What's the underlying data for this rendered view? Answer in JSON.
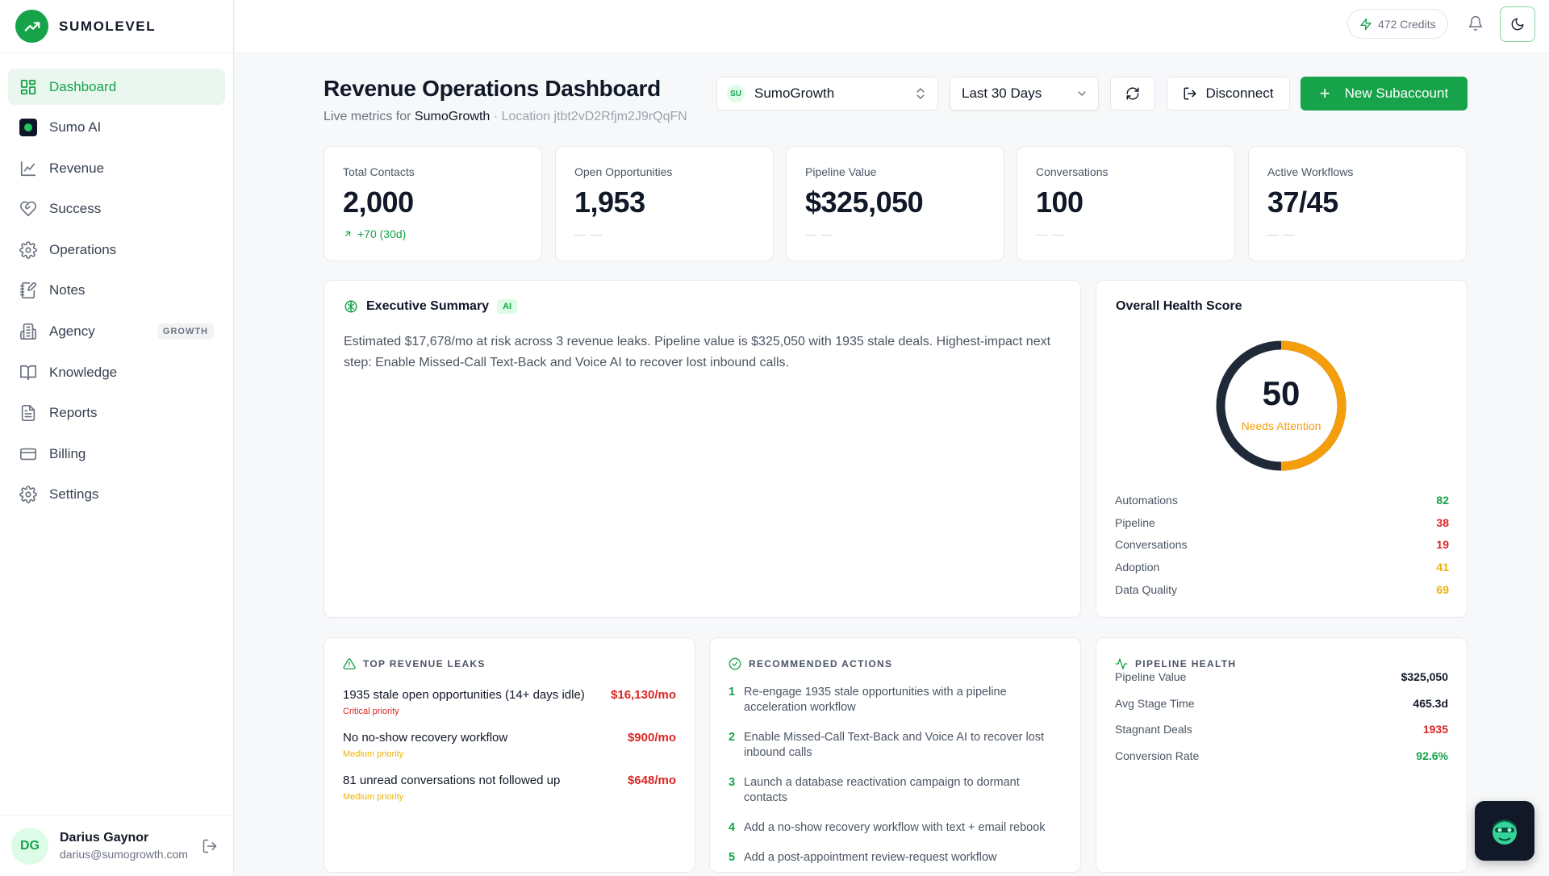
{
  "brand": {
    "name": "SUMOLEVEL"
  },
  "sidebar": {
    "items": [
      {
        "label": "Dashboard",
        "icon": "dashboard-icon",
        "active": true
      },
      {
        "label": "Sumo AI",
        "icon": "sumo-ai-icon"
      },
      {
        "label": "Revenue",
        "icon": "line-chart-icon"
      },
      {
        "label": "Success",
        "icon": "heart-handshake-icon"
      },
      {
        "label": "Operations",
        "icon": "gear-icon"
      },
      {
        "label": "Notes",
        "icon": "notes-icon"
      },
      {
        "label": "Agency",
        "icon": "building-icon",
        "badge": "GROWTH"
      },
      {
        "label": "Knowledge",
        "icon": "book-icon"
      },
      {
        "label": "Reports",
        "icon": "file-text-icon"
      },
      {
        "label": "Billing",
        "icon": "credit-card-icon"
      },
      {
        "label": "Settings",
        "icon": "settings-icon"
      }
    ]
  },
  "user": {
    "initials": "DG",
    "name": "Darius Gaynor",
    "email": "darius@sumogrowth.com"
  },
  "topbar": {
    "credits": "472 Credits"
  },
  "header": {
    "title": "Revenue Operations Dashboard",
    "subtitle_prefix": "Live metrics for",
    "account": "SumoGrowth",
    "location": "· Location jtbt2vD2Rfjm2J9rQqFN"
  },
  "controls": {
    "account_chip": "SU",
    "account_select": "SumoGrowth",
    "range_select": "Last 30 Days",
    "disconnect_label": "Disconnect",
    "new_label": "New Subaccount"
  },
  "kpis": [
    {
      "label": "Total Contacts",
      "value": "2,000",
      "foot": "+70 (30d)"
    },
    {
      "label": "Open Opportunities",
      "value": "1,953",
      "foot": "— —"
    },
    {
      "label": "Pipeline Value",
      "value": "$325,050",
      "foot": "— —"
    },
    {
      "label": "Conversations",
      "value": "100",
      "foot": "— —"
    },
    {
      "label": "Active Workflows",
      "value": "37/45",
      "foot": "— —"
    }
  ],
  "executive": {
    "title": "Executive Summary",
    "chip": "AI",
    "text": "Estimated $17,678/mo at risk across 3 revenue leaks. Pipeline value is $325,050 with 1935 stale deals. Highest-impact next step: Enable Missed-Call Text-Back and Voice AI to recover lost inbound calls."
  },
  "health": {
    "title": "Overall Health Score",
    "score": 50,
    "score_text": "50",
    "status": "Needs Attention",
    "ring_color": "#f59e0b",
    "track_color": "#1f2937",
    "rows": [
      {
        "label": "Automations",
        "value": "82",
        "color": "#16a34a"
      },
      {
        "label": "Pipeline",
        "value": "38",
        "color": "#dc2626"
      },
      {
        "label": "Conversations",
        "value": "19",
        "color": "#dc2626"
      },
      {
        "label": "Adoption",
        "value": "41",
        "color": "#eab308"
      },
      {
        "label": "Data Quality",
        "value": "69",
        "color": "#eab308"
      }
    ]
  },
  "leaks": {
    "title": "TOP REVENUE LEAKS",
    "items": [
      {
        "text": "1935 stale open opportunities (14+ days idle)",
        "priority": "Critical priority",
        "priority_color": "#dc2626",
        "amount": "$16,130/mo"
      },
      {
        "text": "No no-show recovery workflow",
        "priority": "Medium priority",
        "priority_color": "#eab308",
        "amount": "$900/mo"
      },
      {
        "text": "81 unread conversations not followed up",
        "priority": "Medium priority",
        "priority_color": "#eab308",
        "amount": "$648/mo"
      }
    ]
  },
  "actions": {
    "title": "RECOMMENDED ACTIONS",
    "items": [
      {
        "n": "1",
        "text": "Re-engage 1935 stale opportunities with a pipeline acceleration workflow"
      },
      {
        "n": "2",
        "text": "Enable Missed-Call Text-Back and Voice AI to recover lost inbound calls"
      },
      {
        "n": "3",
        "text": "Launch a database reactivation campaign to dormant contacts"
      },
      {
        "n": "4",
        "text": "Add a no-show recovery workflow with text + email rebook"
      },
      {
        "n": "5",
        "text": "Add a post-appointment review-request workflow"
      }
    ]
  },
  "pipeline": {
    "title": "PIPELINE HEALTH",
    "rows": [
      {
        "label": "Pipeline Value",
        "value": "$325,050",
        "color": "#111827"
      },
      {
        "label": "Avg Stage Time",
        "value": "465.3d",
        "color": "#111827"
      },
      {
        "label": "Stagnant Deals",
        "value": "1935",
        "color": "#dc2626"
      },
      {
        "label": "Conversion Rate",
        "value": "92.6%",
        "color": "#16a34a"
      }
    ]
  }
}
